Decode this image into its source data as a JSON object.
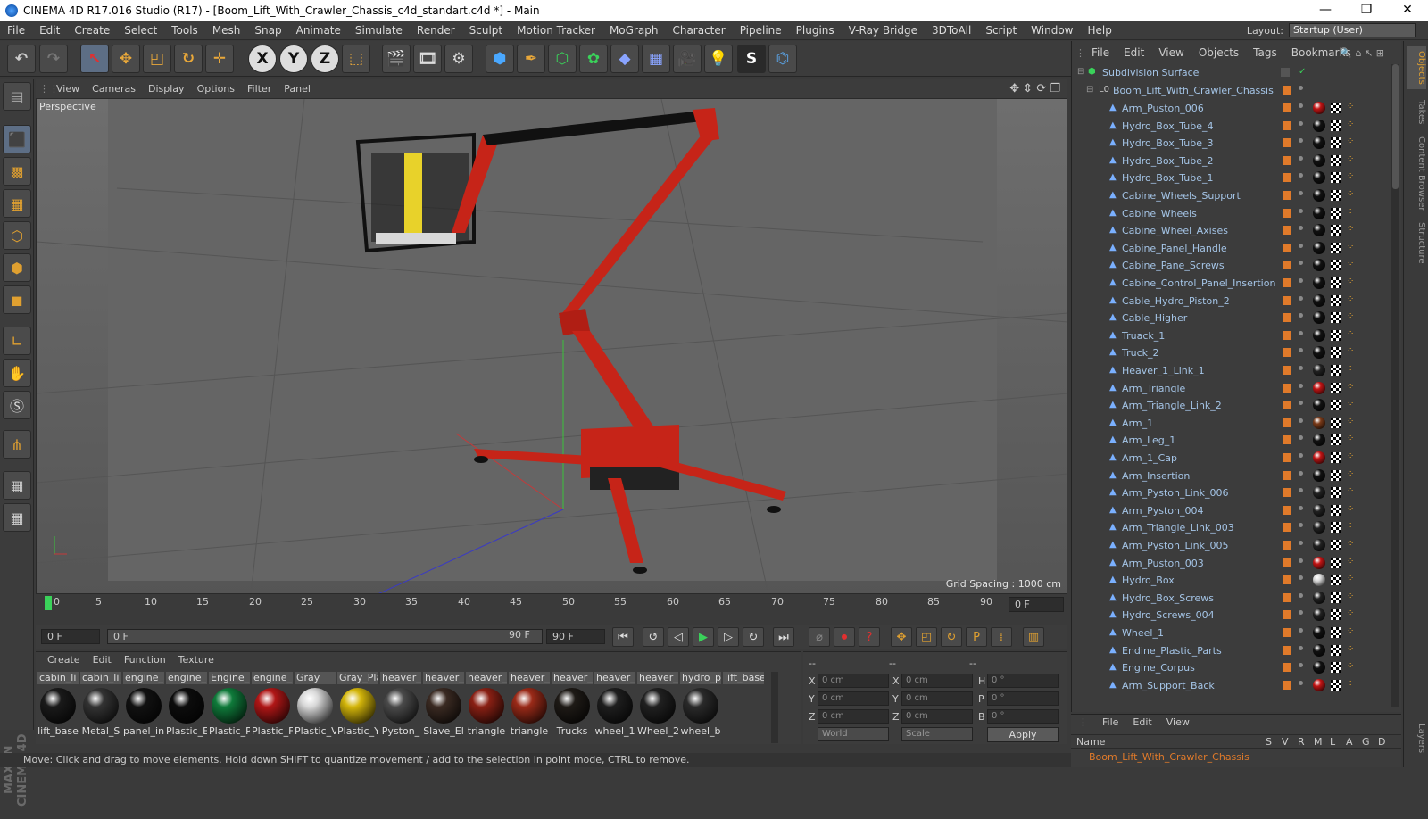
{
  "title": "CINEMA 4D R17.016 Studio (R17) - [Boom_Lift_With_Crawler_Chassis_c4d_standart.c4d *] - Main",
  "window_controls": [
    "—",
    "❐",
    "✕"
  ],
  "menu": [
    "File",
    "Edit",
    "Create",
    "Select",
    "Tools",
    "Mesh",
    "Snap",
    "Animate",
    "Simulate",
    "Render",
    "Sculpt",
    "Motion Tracker",
    "MoGraph",
    "Character",
    "Pipeline",
    "Plugins",
    "V-Ray Bridge",
    "3DToAll",
    "Script",
    "Window",
    "Help"
  ],
  "layout": {
    "label": "Layout:",
    "value": "Startup (User)"
  },
  "toolbar": {
    "x": "X",
    "y": "Y",
    "z": "Z"
  },
  "viewport": {
    "menu": [
      "View",
      "Cameras",
      "Display",
      "Options",
      "Filter",
      "Panel"
    ],
    "label": "Perspective",
    "grid_spacing": "Grid Spacing : 1000 cm"
  },
  "timeline": {
    "ticks": [
      "0",
      "5",
      "10",
      "15",
      "20",
      "25",
      "30",
      "35",
      "40",
      "45",
      "50",
      "55",
      "60",
      "65",
      "70",
      "75",
      "80",
      "85",
      "90"
    ],
    "frame_end": "0 F"
  },
  "transport": {
    "start": "0 F",
    "range_start": "0 F",
    "range_end": "90 F",
    "end": "90 F"
  },
  "materials": {
    "menu": [
      "Create",
      "Edit",
      "Function",
      "Texture"
    ],
    "top": [
      "cabin_li",
      "cabin_li",
      "engine_",
      "engine_",
      "Engine_",
      "engine_",
      "Gray",
      "Gray_Pla",
      "heaver_",
      "heaver_",
      "heaver_",
      "heaver_",
      "heaver_",
      "heaver_",
      "heaver_",
      "hydro_p",
      "lift_base"
    ],
    "items": [
      {
        "label": "lift_base",
        "color": "#1a1a1a"
      },
      {
        "label": "Metal_S",
        "color": "#333"
      },
      {
        "label": "panel_in",
        "color": "#111"
      },
      {
        "label": "Plastic_E",
        "color": "#0c0c0c"
      },
      {
        "label": "Plastic_P",
        "color": "#0f7a3a"
      },
      {
        "label": "Plastic_F",
        "color": "#b01616"
      },
      {
        "label": "Plastic_V",
        "color": "#d8d8d8"
      },
      {
        "label": "Plastic_Y",
        "color": "#d4b60a"
      },
      {
        "label": "Pyston_",
        "color": "#4a4a4a"
      },
      {
        "label": "Slave_El",
        "color": "#3a2a22"
      },
      {
        "label": "triangle",
        "color": "#8a2014"
      },
      {
        "label": "triangle",
        "color": "#9a2a18"
      },
      {
        "label": "Trucks",
        "color": "#1e1a16"
      },
      {
        "label": "wheel_1",
        "color": "#1e1e1e"
      },
      {
        "label": "Wheel_2",
        "color": "#202020"
      },
      {
        "label": "wheel_b",
        "color": "#2a2a2a"
      }
    ]
  },
  "coord": {
    "header": [
      "--",
      "--",
      "--"
    ],
    "x": "X",
    "y": "Y",
    "z": "Z",
    "h": "H",
    "p": "P",
    "b": "B",
    "pos_x": "0 cm",
    "pos_y": "0 cm",
    "pos_z": "0 cm",
    "size_x": "0 cm",
    "size_y": "0 cm",
    "size_z": "0 cm",
    "rot_h": "0 °",
    "rot_p": "0 °",
    "rot_b": "0 °",
    "mode": "World",
    "scale": "Scale",
    "apply": "Apply"
  },
  "status": "Move: Click and drag to move elements. Hold down SHIFT to quantize movement / add to the selection in point mode, CTRL to remove.",
  "objects": {
    "menu": [
      "File",
      "Edit",
      "View",
      "Objects",
      "Tags",
      "Bookmarks"
    ],
    "subdiv": "Subdivision Surface",
    "root": "Boom_Lift_With_Crawler_Chassis",
    "items": [
      {
        "name": "Arm_Puston_006",
        "mat": "#c21414"
      },
      {
        "name": "Hydro_Box_Tube_4",
        "mat": "#111"
      },
      {
        "name": "Hydro_Box_Tube_3",
        "mat": "#111"
      },
      {
        "name": "Hydro_Box_Tube_2",
        "mat": "#111"
      },
      {
        "name": "Hydro_Box_Tube_1",
        "mat": "#111"
      },
      {
        "name": "Cabine_Wheels_Support",
        "mat": "#111"
      },
      {
        "name": "Cabine_Wheels",
        "mat": "#111"
      },
      {
        "name": "Cabine_Wheel_Axises",
        "mat": "#111"
      },
      {
        "name": "Cabine_Panel_Handle",
        "mat": "#111"
      },
      {
        "name": "Cabine_Pane_Screws",
        "mat": "#111"
      },
      {
        "name": "Cabine_Control_Panel_Insertion",
        "mat": "#111"
      },
      {
        "name": "Cable_Hydro_Piston_2",
        "mat": "#111"
      },
      {
        "name": "Cable_Higher",
        "mat": "#111"
      },
      {
        "name": "Truack_1",
        "mat": "#111"
      },
      {
        "name": "Truck_2",
        "mat": "#111"
      },
      {
        "name": "Heaver_1_Link_1",
        "mat": "#222"
      },
      {
        "name": "Arm_Triangle",
        "mat": "#c21414"
      },
      {
        "name": "Arm_Triangle_Link_2",
        "mat": "#111"
      },
      {
        "name": "Arm_1",
        "mat": "#7a3a18"
      },
      {
        "name": "Arm_Leg_1",
        "mat": "#111"
      },
      {
        "name": "Arm_1_Cap",
        "mat": "#c21414"
      },
      {
        "name": "Arm_Insertion",
        "mat": "#111"
      },
      {
        "name": "Arm_Pyston_Link_006",
        "mat": "#222"
      },
      {
        "name": "Arm_Pyston_004",
        "mat": "#222"
      },
      {
        "name": "Arm_Triangle_Link_003",
        "mat": "#222"
      },
      {
        "name": "Arm_Pyston_Link_005",
        "mat": "#222"
      },
      {
        "name": "Arm_Puston_003",
        "mat": "#c21414"
      },
      {
        "name": "Hydro_Box",
        "mat": "#d8d8d8"
      },
      {
        "name": "Hydro_Box_Screws",
        "mat": "#222"
      },
      {
        "name": "Hydro_Screws_004",
        "mat": "#222"
      },
      {
        "name": "Wheel_1",
        "mat": "#111"
      },
      {
        "name": "Endine_Plastic_Parts",
        "mat": "#111"
      },
      {
        "name": "Engine_Corpus",
        "mat": "#111"
      },
      {
        "name": "Arm_Support_Back",
        "mat": "#c21414"
      }
    ]
  },
  "attributes": {
    "menu": [
      "File",
      "Edit",
      "View"
    ],
    "name_col": "Name",
    "cols": [
      "S",
      "V",
      "R",
      "M",
      "L",
      "A",
      "G",
      "D"
    ],
    "row": "Boom_Lift_With_Crawler_Chassis"
  },
  "right_tabs": [
    "Objects",
    "Takes",
    "Content Browser",
    "Structure",
    "Layers"
  ],
  "colors": {
    "accent": "#e07a2a",
    "boom_red": "#d42a1a",
    "link_blue": "#a4c4e6"
  }
}
